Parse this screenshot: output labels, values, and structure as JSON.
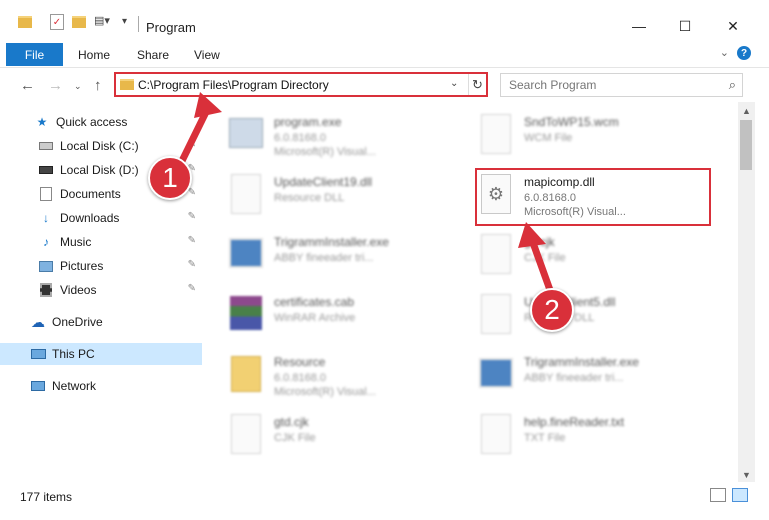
{
  "window": {
    "title": "Program",
    "minimize": "—",
    "maximize": "☐",
    "close": "✕"
  },
  "ribbon": {
    "file": "File",
    "home": "Home",
    "share": "Share",
    "view": "View",
    "help": "?"
  },
  "address": {
    "path": "C:\\Program Files\\Program Directory",
    "search_placeholder": "Search Program"
  },
  "sidebar": {
    "items": [
      {
        "label": "Quick access",
        "icon": "star-icon"
      },
      {
        "label": "Local Disk (C:)",
        "icon": "drive-icon"
      },
      {
        "label": "Local Disk (D:)",
        "icon": "drive-icon"
      },
      {
        "label": "Documents",
        "icon": "documents-icon"
      },
      {
        "label": "Downloads",
        "icon": "download-icon"
      },
      {
        "label": "Music",
        "icon": "music-icon"
      },
      {
        "label": "Pictures",
        "icon": "pictures-icon"
      },
      {
        "label": "Videos",
        "icon": "videos-icon"
      },
      {
        "label": "OneDrive",
        "icon": "cloud-icon"
      },
      {
        "label": "This PC",
        "icon": "computer-icon"
      },
      {
        "label": "Network",
        "icon": "network-icon"
      }
    ]
  },
  "files": [
    {
      "name": "program.exe",
      "line1": "6.0.8168.0",
      "line2": "Microsoft(R) Visual..."
    },
    {
      "name": "SndToWP15.wcm",
      "line1": "WCM File",
      "line2": ""
    },
    {
      "name": "UpdateClient19.dll",
      "line1": "Resource DLL",
      "line2": ""
    },
    {
      "name": "mapicomp.dll",
      "line1": "6.0.8168.0",
      "line2": "Microsoft(R) Visual..."
    },
    {
      "name": "TrigrammInstaller.exe",
      "line1": "ABBY fineeader tri...",
      "line2": ""
    },
    {
      "name": "gtl.cjk",
      "line1": "CJK File",
      "line2": ""
    },
    {
      "name": "certificates.cab",
      "line1": "WinRAR Archive",
      "line2": ""
    },
    {
      "name": "UpdateClient5.dll",
      "line1": "Resource DLL",
      "line2": ""
    },
    {
      "name": "Resource",
      "line1": "6.0.8168.0",
      "line2": "Microsoft(R) Visual..."
    },
    {
      "name": "TrigrammInstaller.exe",
      "line1": "ABBY fineeader tri...",
      "line2": ""
    },
    {
      "name": "gtd.cjk",
      "line1": "CJK File",
      "line2": ""
    },
    {
      "name": "help.fineReader.txt",
      "line1": "TXT File",
      "line2": ""
    }
  ],
  "status": {
    "count": "177 items"
  },
  "badges": {
    "one": "1",
    "two": "2"
  },
  "colors": {
    "accent": "#1979ca",
    "highlight": "#d9303a",
    "selection": "#cce8ff"
  }
}
